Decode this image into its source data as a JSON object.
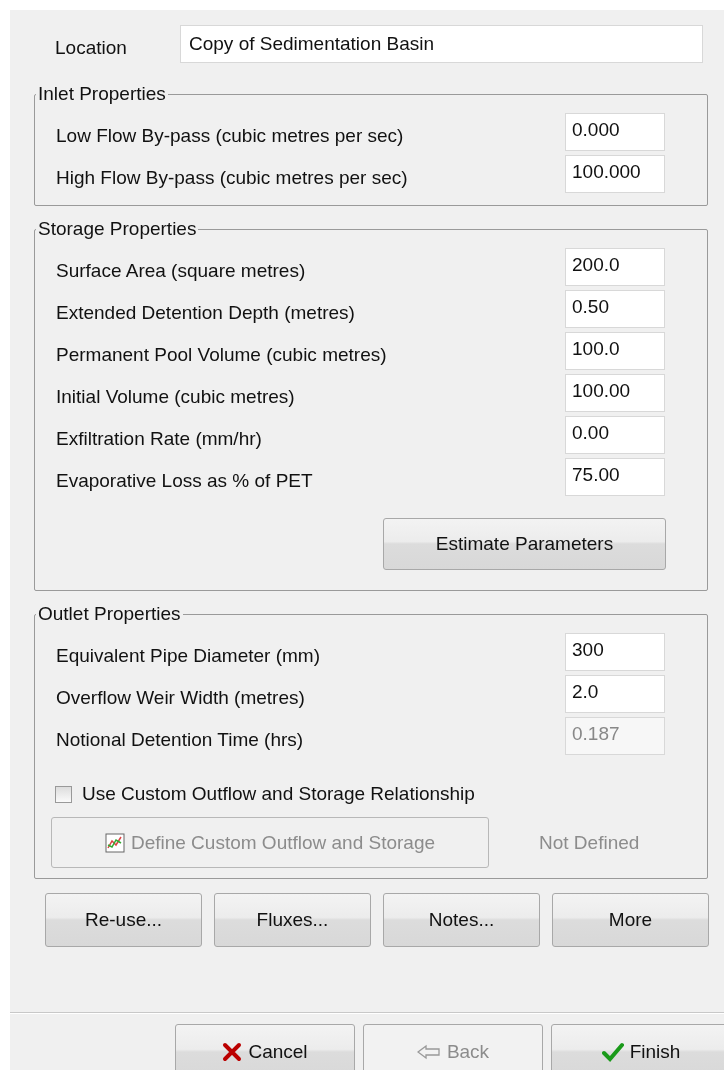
{
  "location": {
    "label": "Location",
    "value": "Copy of Sedimentation Basin"
  },
  "inlet": {
    "title": "Inlet Properties",
    "fields": [
      {
        "label": "Low Flow By-pass (cubic metres per sec)",
        "value": "0.000",
        "disabled": false
      },
      {
        "label": "High Flow By-pass (cubic metres per sec)",
        "value": "100.000",
        "disabled": false
      }
    ]
  },
  "storage": {
    "title": "Storage Properties",
    "fields": [
      {
        "label": "Surface Area (square metres)",
        "value": "200.0",
        "disabled": false
      },
      {
        "label": "Extended Detention Depth (metres)",
        "value": "0.50",
        "disabled": false
      },
      {
        "label": "Permanent Pool Volume (cubic metres)",
        "value": "100.0",
        "disabled": false
      },
      {
        "label": "Initial Volume (cubic metres)",
        "value": "100.00",
        "disabled": false
      },
      {
        "label": "Exfiltration Rate (mm/hr)",
        "value": "0.00",
        "disabled": false
      },
      {
        "label": "Evaporative Loss as % of PET",
        "value": "75.00",
        "disabled": false
      }
    ],
    "button": "Estimate Parameters"
  },
  "outlet": {
    "title": "Outlet Properties",
    "fields": [
      {
        "label": "Equivalent Pipe Diameter (mm)",
        "value": "300",
        "disabled": false
      },
      {
        "label": "Overflow Weir Width (metres)",
        "value": "2.0",
        "disabled": false
      },
      {
        "label": "Notional Detention Time (hrs)",
        "value": "0.187",
        "disabled": true
      }
    ],
    "checkbox": {
      "label": "Use Custom Outflow and Storage Relationship",
      "checked": false
    },
    "define_button": {
      "label": "Define Custom Outflow and Storage",
      "disabled": true
    },
    "status": "Not Defined"
  },
  "actions": [
    "Re-use...",
    "Fluxes...",
    "Notes...",
    "More"
  ],
  "wizard_buttons": [
    {
      "label": "Cancel",
      "kind": "cancel",
      "disabled": false
    },
    {
      "label": "Back",
      "kind": "back",
      "disabled": true
    },
    {
      "label": "Finish",
      "kind": "finish",
      "disabled": false
    }
  ]
}
